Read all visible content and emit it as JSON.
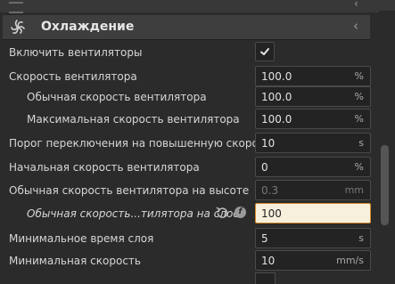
{
  "section": {
    "title": "Охлаждение",
    "icon": "fan-icon"
  },
  "settings": {
    "enable_fans": {
      "label": "Включить вентиляторы",
      "checked": true
    },
    "fan_speed": {
      "label": "Скорость вентилятора",
      "value": "100.0",
      "unit": "%"
    },
    "regular_fan_speed": {
      "label": "Обычная скорость вентилятора",
      "value": "100.0",
      "unit": "%"
    },
    "max_fan_speed": {
      "label": "Максимальная скорость вентилятора",
      "value": "100.0",
      "unit": "%"
    },
    "max_speed_threshold": {
      "label": "Порог переключения на повышенную скорость",
      "value": "10",
      "unit": "s"
    },
    "initial_fan_speed": {
      "label": "Начальная скорость вентилятора",
      "value": "0",
      "unit": "%"
    },
    "regular_fan_speed_at_height": {
      "label": "Обычная скорость вентилятора на высоте",
      "value": "0.3",
      "unit": "mm"
    },
    "regular_fan_speed_at_layer": {
      "label": "Обычная скорость...тилятора на слое",
      "value": "100",
      "unit": ""
    },
    "min_layer_time": {
      "label": "Минимальное время слоя",
      "value": "5",
      "unit": "s"
    },
    "min_speed": {
      "label": "Минимальная скорость",
      "value": "10",
      "unit": "mm/s"
    }
  }
}
